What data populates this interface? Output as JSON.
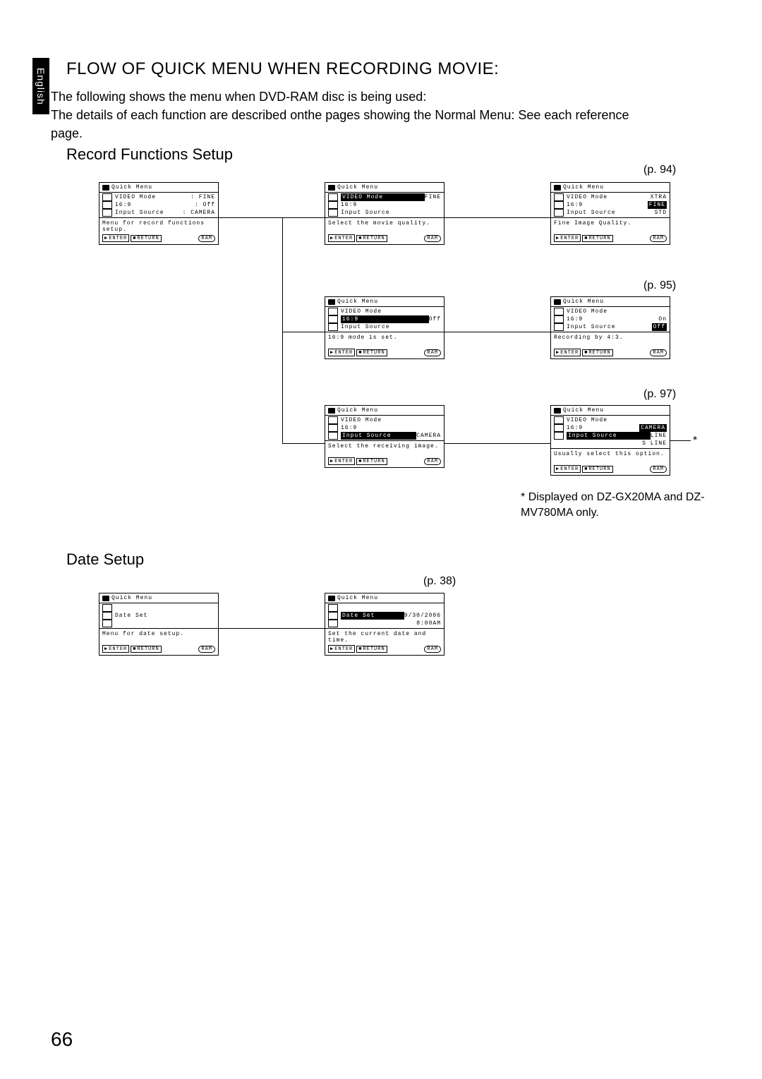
{
  "lang_tab": "English",
  "title": "FLOW OF QUICK MENU WHEN RECORDING MOVIE:",
  "intro_line1": "The following shows the menu when  DVD-RAM disc is being used:",
  "intro_line2": "The details of each function are described onthe pages showing the Normal Menu: See each reference page.",
  "section_record": "Record Functions Setup",
  "section_date": "Date Setup",
  "page_number": "66",
  "refs": {
    "p94": "(p. 94)",
    "p95": "(p. 95)",
    "p97": "(p. 97)",
    "p38": "(p. 38)"
  },
  "footnote_star": "*",
  "footnote_text": "Displayed on DZ-GX20MA and DZ-MV780MA only.",
  "common": {
    "quick_menu": "Quick Menu",
    "enter": "ENTER",
    "return": "RETURN",
    "ram": "RAM"
  },
  "menus": {
    "m1": {
      "r1l": "VIDEO Mode",
      "r1v": ": FINE",
      "r2l": "16:9",
      "r2v": ": Off",
      "r3l": "Input Source",
      "r3v": ": CAMERA",
      "desc": "Menu for record functions setup."
    },
    "m2": {
      "r1l": "VIDEO Mode",
      "r1v": "FINE",
      "r2l": "16:9",
      "r2v": "",
      "r3l": "Input Source",
      "r3v": "",
      "desc": "Select the movie quality."
    },
    "m3": {
      "r1l": "VIDEO Mode",
      "r1v": "XTRA",
      "r2l": "16:9",
      "r2v": "FINE",
      "r3l": "Input Source",
      "r3v": "STD",
      "desc": "Fine Image Quality."
    },
    "m4": {
      "r1l": "VIDEO Mode",
      "r1v": "",
      "r2l": "16:9",
      "r2v": "Off",
      "r3l": "Input Source",
      "r3v": "",
      "desc": "16:9 mode is set."
    },
    "m5": {
      "r1l": "VIDEO Mode",
      "r1v": "",
      "r2l": "16:9",
      "r2v": "On",
      "r3l": "Input Source",
      "r3v": "Off",
      "desc": "Recording by 4:3."
    },
    "m6": {
      "r1l": "VIDEO Mode",
      "r1v": "",
      "r2l": "16:9",
      "r2v": "",
      "r3l": "Input Source",
      "r3v": "CAMERA",
      "desc": "Select the receiving image."
    },
    "m7": {
      "r1l": "VIDEO Mode",
      "r1v": "",
      "r2l": "16:9",
      "r2v": "CAMERA",
      "r3l": "Input Source",
      "r3v": "LINE",
      "r4v": "S LINE",
      "desc": "Usually select this option."
    },
    "d1": {
      "r2l": "Date Set",
      "desc": "Menu for date setup."
    },
    "d2": {
      "r2l": "Date Set",
      "r2va": "9/30/2006",
      "r2vb": "8:00AM",
      "desc": "Set the current date and time."
    }
  }
}
